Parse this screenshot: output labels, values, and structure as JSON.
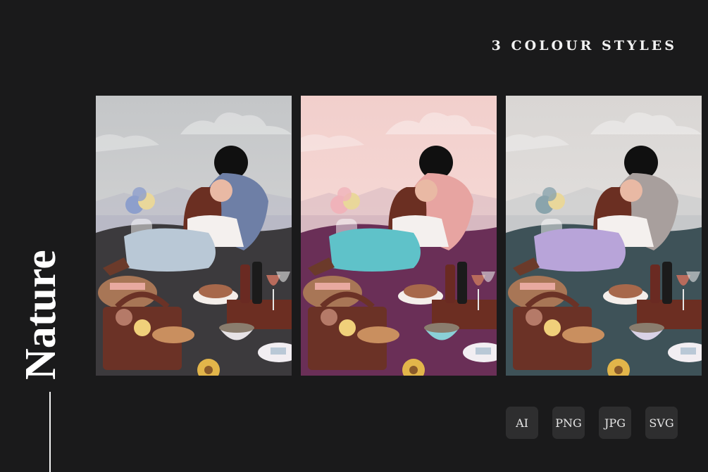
{
  "headline": "3 COLOUR STYLES",
  "side_title": "Nature",
  "formats": [
    "AI",
    "PNG",
    "JPG",
    "SVG"
  ],
  "panels": [
    {
      "sky_top": "#c4c6c8",
      "sky_bottom": "#dcdcdc",
      "sea": "#b9b9c6",
      "blanket": "#3c3a3d",
      "pants": "#b9c8d6",
      "dress": "#6e7fa6",
      "flowers": "#8d9fcc",
      "bowl": "#e7e3e6"
    },
    {
      "sky_top": "#f2cfcc",
      "sky_bottom": "#f8e2de",
      "sea": "#d7b9c1",
      "blanket": "#6a2f57",
      "pants": "#5fc2c9",
      "dress": "#e7a4a1",
      "flowers": "#f0b3ba",
      "bowl": "#8ad0d8"
    },
    {
      "sky_top": "#d9d6d4",
      "sky_bottom": "#ebe8e6",
      "sea": "#c6c8ca",
      "blanket": "#3e5258",
      "pants": "#b8a4d9",
      "dress": "#a89f9d",
      "flowers": "#8aa4ac",
      "bowl": "#d9d2e6"
    }
  ]
}
